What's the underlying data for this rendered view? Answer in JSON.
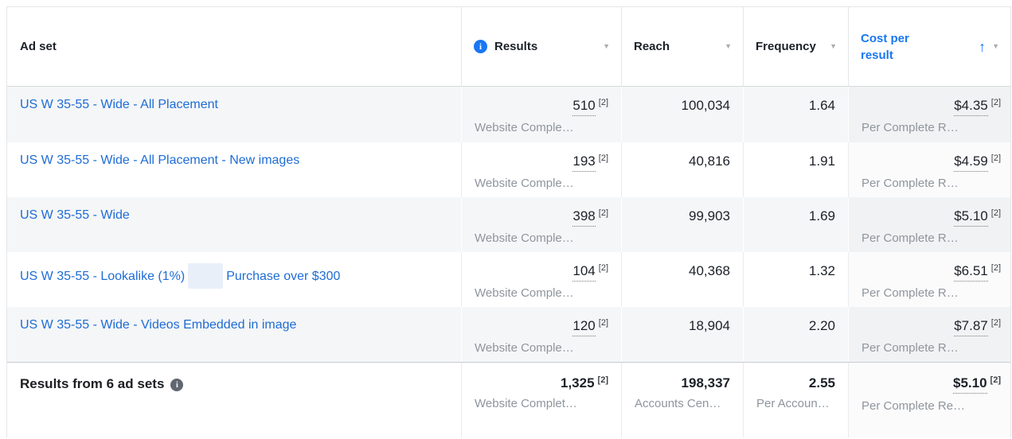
{
  "colors": {
    "link_blue": "#1e6cd5",
    "sorted_header_blue": "#1877f2",
    "info_icon_blue": "#1877f2",
    "footer_info_gray": "#606770",
    "row_stripe_gray": "#f5f6f7",
    "text_primary": "#1c1e21",
    "text_secondary": "#8f959e"
  },
  "icons": {
    "caret_down": "▼",
    "sort_ascending_arrow": "↑",
    "info": "i"
  },
  "header": {
    "adset": {
      "label": "Ad set"
    },
    "results": {
      "label": "Results",
      "has_info_icon": true
    },
    "reach": {
      "label": "Reach"
    },
    "frequency": {
      "label": "Frequency"
    },
    "cost": {
      "label": "Cost per result",
      "sort_direction": "ascending"
    }
  },
  "rows": [
    {
      "adset": "US W 35-55 - Wide - All Placement",
      "results": {
        "value": "510",
        "sup": "[2]",
        "label": "Website Comple…"
      },
      "reach": "100,034",
      "frequency": "1.64",
      "cost": {
        "value": "$4.35",
        "sup": "[2]",
        "label": "Per Complete R…"
      }
    },
    {
      "adset": "US W 35-55 - Wide - All Placement - New images",
      "results": {
        "value": "193",
        "sup": "[2]",
        "label": "Website Comple…"
      },
      "reach": "40,816",
      "frequency": "1.91",
      "cost": {
        "value": "$4.59",
        "sup": "[2]",
        "label": "Per Complete R…"
      }
    },
    {
      "adset": "US W 35-55 - Wide",
      "results": {
        "value": "398",
        "sup": "[2]",
        "label": "Website Comple…"
      },
      "reach": "99,903",
      "frequency": "1.69",
      "cost": {
        "value": "$5.10",
        "sup": "[2]",
        "label": "Per Complete R…"
      }
    },
    {
      "adset": "US W 35-55 - Lookalike (1%)",
      "adset_suffix": "Purchase over $300",
      "adset_redacted": true,
      "results": {
        "value": "104",
        "sup": "[2]",
        "label": "Website Comple…"
      },
      "reach": "40,368",
      "frequency": "1.32",
      "cost": {
        "value": "$6.51",
        "sup": "[2]",
        "label": "Per Complete R…"
      }
    },
    {
      "adset": "US W 35-55 - Wide - Videos Embedded in image",
      "results": {
        "value": "120",
        "sup": "[2]",
        "label": "Website Comple…"
      },
      "reach": "18,904",
      "frequency": "2.20",
      "cost": {
        "value": "$7.87",
        "sup": "[2]",
        "label": "Per Complete R…"
      }
    }
  ],
  "footer": {
    "label": "Results from 6 ad sets",
    "results": {
      "value": "1,325",
      "sup": "[2]",
      "label": "Website Complet…"
    },
    "reach": {
      "value": "198,337",
      "label": "Accounts Cen…"
    },
    "frequency": {
      "value": "2.55",
      "label": "Per Accoun…"
    },
    "cost": {
      "value": "$5.10",
      "sup": "[2]",
      "label": "Per Complete Re…"
    }
  }
}
